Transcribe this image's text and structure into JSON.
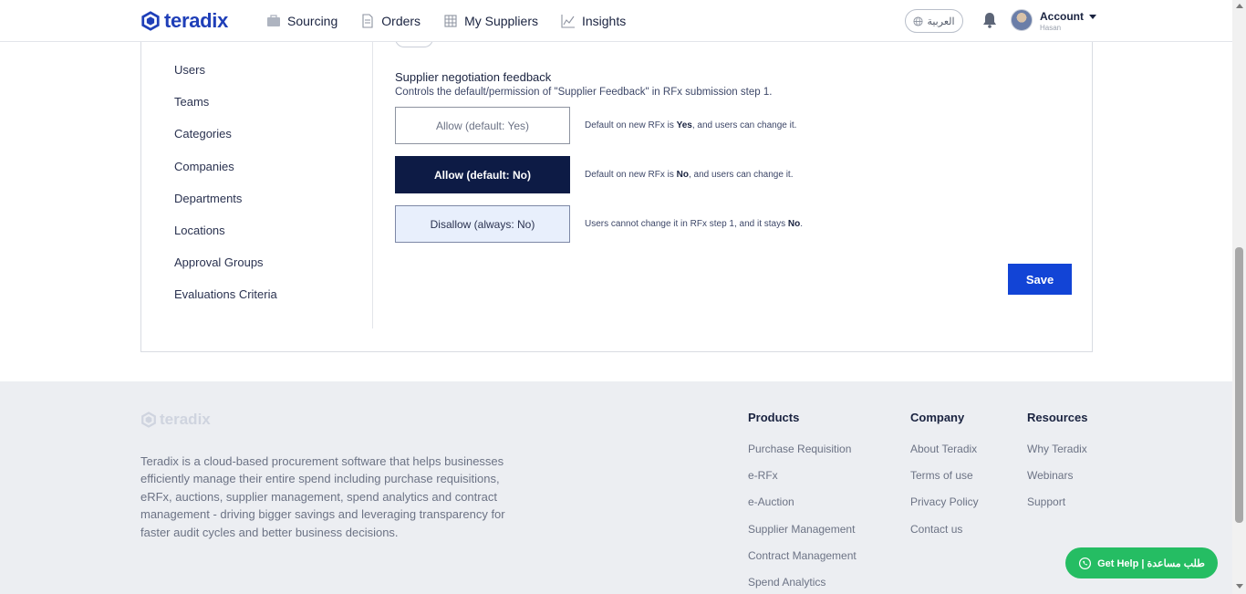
{
  "brand": {
    "name": "teradix",
    "color": "#1f3fb8"
  },
  "nav": {
    "items": [
      {
        "label": "Sourcing",
        "icon": "briefcase-icon"
      },
      {
        "label": "Orders",
        "icon": "document-icon"
      },
      {
        "label": "My Suppliers",
        "icon": "building-icon"
      },
      {
        "label": "Insights",
        "icon": "chart-icon"
      }
    ],
    "language": "العربية",
    "account": {
      "label": "Account",
      "user": "Hasan"
    }
  },
  "sidebar": {
    "items": [
      {
        "label": "Users"
      },
      {
        "label": "Teams"
      },
      {
        "label": "Categories"
      },
      {
        "label": "Companies"
      },
      {
        "label": "Departments"
      },
      {
        "label": "Locations"
      },
      {
        "label": "Approval Groups"
      },
      {
        "label": "Evaluations Criteria"
      }
    ]
  },
  "settings": {
    "title": "Supplier negotiation feedback",
    "description": "Controls the default/permission of \"Supplier Feedback\" in RFx submission step 1.",
    "options": [
      {
        "label": "Allow (default: Yes)",
        "desc_pre": "Default on new RFx is ",
        "desc_bold": "Yes",
        "desc_post": ", and users can change it."
      },
      {
        "label": "Allow (default: No)",
        "desc_pre": "Default on new RFx is ",
        "desc_bold": "No",
        "desc_post": ", and users can change it."
      },
      {
        "label": "Disallow (always: No)",
        "desc_pre": "Users cannot change it in RFx step 1, and it stays ",
        "desc_bold": "No",
        "desc_post": "."
      }
    ],
    "selected": "Allow (default: No)",
    "save_label": "Save"
  },
  "footer": {
    "brand": "teradix",
    "description": "Teradix is a cloud-based procurement software that helps businesses efficiently manage their entire spend including purchase requisitions, eRFx, auctions, supplier management, spend analytics and contract management - driving bigger savings and leveraging transparency for faster audit cycles and better business decisions.",
    "columns": [
      {
        "title": "Products",
        "links": [
          "Purchase Requisition",
          "e-RFx",
          "e-Auction",
          "Supplier Management",
          "Contract Management",
          "Spend Analytics"
        ]
      },
      {
        "title": "Company",
        "links": [
          "About Teradix",
          "Terms of use",
          "Privacy Policy",
          "Contact us"
        ]
      },
      {
        "title": "Resources",
        "links": [
          "Why Teradix",
          "Webinars",
          "Support"
        ]
      }
    ]
  },
  "help": {
    "label": "Get Help | طلب مساعدة",
    "icon": "whatsapp-icon",
    "color": "#25bd63"
  }
}
